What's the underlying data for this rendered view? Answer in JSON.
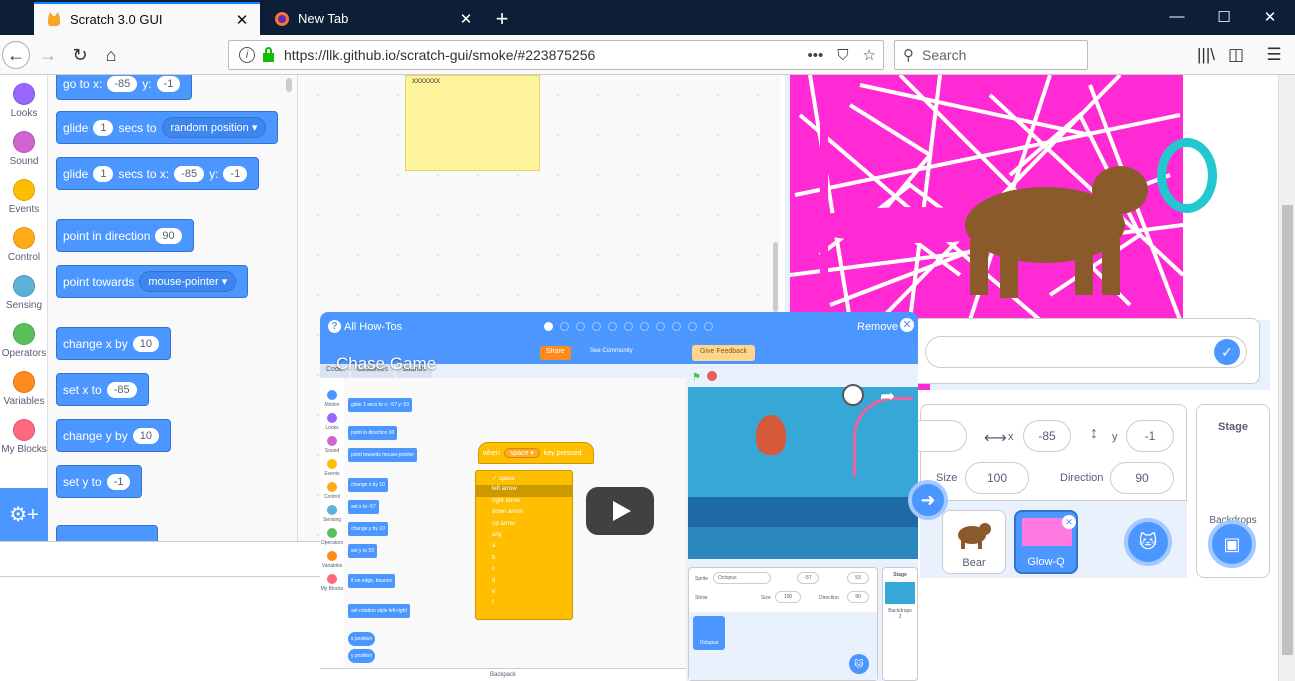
{
  "browser": {
    "tabs": [
      {
        "label": "Scratch 3.0 GUI",
        "active": true
      },
      {
        "label": "New Tab",
        "active": false
      }
    ],
    "url": "https://llk.github.io/scratch-gui/smoke/#223875256",
    "search_placeholder": "Search",
    "icons": [
      "back-icon",
      "forward-icon",
      "reload-icon",
      "home-icon",
      "page-actions-icon",
      "pocket-icon",
      "bookmark-star-icon",
      "library-icon",
      "sidebar-icon",
      "menu-icon"
    ]
  },
  "categories": [
    {
      "label": "Looks",
      "color": "#9966ff"
    },
    {
      "label": "Sound",
      "color": "#cf63cf"
    },
    {
      "label": "Events",
      "color": "#ffbf00"
    },
    {
      "label": "Control",
      "color": "#ffab19"
    },
    {
      "label": "Sensing",
      "color": "#5cb1d6"
    },
    {
      "label": "Operators",
      "color": "#59c059"
    },
    {
      "label": "Variables",
      "color": "#ff8c1a"
    },
    {
      "label": "My Blocks",
      "color": "#ff6680"
    }
  ],
  "blocks": {
    "goto": {
      "label": "go to x:",
      "x": "-85",
      "ylabel": "y:",
      "y": "-1"
    },
    "glide_random": {
      "label": "glide",
      "secs": "1",
      "mid": "secs to",
      "target": "random position"
    },
    "glide_xy": {
      "label": "glide",
      "secs": "1",
      "mid": "secs to x:",
      "x": "-85",
      "ylabel": "y:",
      "y": "-1"
    },
    "point_dir": {
      "label": "point in direction",
      "value": "90"
    },
    "point_towards": {
      "label": "point towards",
      "target": "mouse-pointer"
    },
    "change_x": {
      "label": "change x by",
      "value": "10"
    },
    "set_x": {
      "label": "set x to",
      "value": "-85"
    },
    "change_y": {
      "label": "change y by",
      "value": "10"
    },
    "set_y": {
      "label": "set y to",
      "value": "-1"
    }
  },
  "note_text": "xxxxxxx",
  "sprite_info": {
    "x_label": "x",
    "x_value": "-85",
    "y_label": "y",
    "y_value": "-1",
    "size_label": "Size",
    "size_value": "100",
    "direction_label": "Direction",
    "direction_value": "90"
  },
  "sprites": [
    {
      "name": "Bear",
      "selected": false
    },
    {
      "name": "Glow-Q",
      "selected": true
    }
  ],
  "stage_pane": {
    "title": "Stage",
    "backdrops_label": "Backdrops"
  },
  "howto": {
    "title": "All How-Tos",
    "remove_label": "Remove",
    "page_count": 11,
    "current_page": 1,
    "video": {
      "title": "Chase Game",
      "share_label": "Share",
      "see_community": "See Community",
      "feedback_label": "Give Feedback",
      "tabs": [
        "Code",
        "Costumes",
        "Sounds"
      ],
      "categories": [
        "Motion",
        "Looks",
        "Sound",
        "Events",
        "Control",
        "Sensing",
        "Operators",
        "Variables",
        "My Blocks"
      ],
      "blocks": [
        {
          "label": "glide 1 secs to x: -57 y: 53"
        },
        {
          "label": "point in direction 90"
        },
        {
          "label": "point towards mouse-pointer"
        },
        {
          "label": "change x by 10"
        },
        {
          "label": "set x to -57"
        },
        {
          "label": "change y by 10"
        },
        {
          "label": "set y to 53"
        },
        {
          "label": "if on edge, bounce"
        },
        {
          "label": "set rotation style left-right"
        },
        {
          "label": "x position"
        },
        {
          "label": "y position"
        }
      ],
      "hat_when": "when",
      "hat_key": "space",
      "hat_rest": "key pressed",
      "dropdown": [
        "space",
        "left arrow",
        "right arrow",
        "down arrow",
        "up arrow",
        "any",
        "a",
        "b",
        "c",
        "d",
        "e",
        "f"
      ],
      "sprite_label": "Sprite",
      "sprite_name": "Octopus",
      "x_value": "-57",
      "y_value": "53",
      "show_label": "Show",
      "size_label": "Size",
      "size_value": "100",
      "direction_label": "Direction",
      "direction_value": "90",
      "stage_label": "Stage",
      "backdrops_label": "Backdrops",
      "backdrops_count": "2",
      "octopus_thumb": "Octopus",
      "backpack_label": "Backpack"
    }
  }
}
